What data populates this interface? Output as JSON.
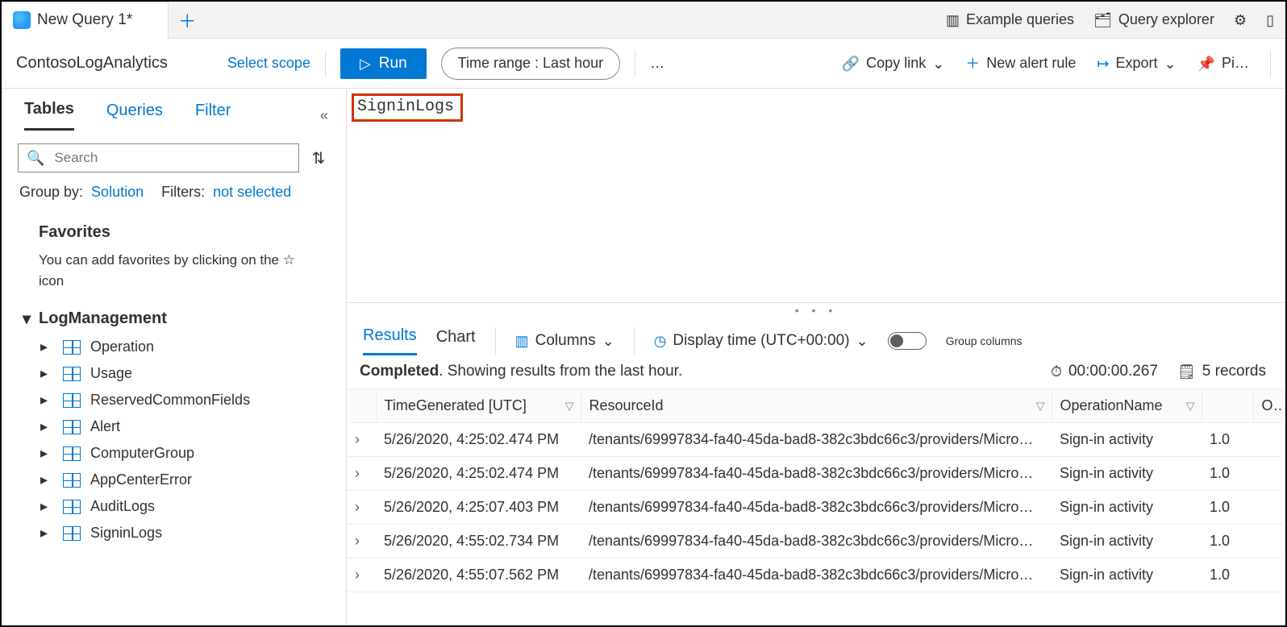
{
  "tabStrip": {
    "activeTab": "New Query 1*",
    "rightItems": {
      "exampleQueries": "Example queries",
      "queryExplorer": "Query explorer"
    }
  },
  "commandBar": {
    "workspace": "ContosoLogAnalytics",
    "selectScope": "Select scope",
    "run": "Run",
    "timeRangeLabel": "Time range :",
    "timeRangeValue": "Last hour",
    "more": "…",
    "copyLink": "Copy link",
    "newAlert": "New alert rule",
    "export": "Export",
    "pin": "Pi…"
  },
  "sidebar": {
    "tabs": {
      "tables": "Tables",
      "queries": "Queries",
      "filter": "Filter"
    },
    "searchPlaceholder": "Search",
    "groupByLabel": "Group by:",
    "groupByValue": "Solution",
    "filtersLabel": "Filters:",
    "filtersValue": "not selected",
    "favoritesTitle": "Favorites",
    "favoritesDesc": "You can add favorites by clicking on the ☆ icon",
    "groupName": "LogManagement",
    "tables": [
      "Operation",
      "Usage",
      "ReservedCommonFields",
      "Alert",
      "ComputerGroup",
      "AppCenterError",
      "AuditLogs",
      "SigninLogs"
    ]
  },
  "editor": {
    "queryText": "SigninLogs"
  },
  "resultsBar": {
    "tabResults": "Results",
    "tabChart": "Chart",
    "columns": "Columns",
    "displayTime": "Display time (UTC+00:00)",
    "groupColumns": "Group columns"
  },
  "statusRow": {
    "completed": "Completed",
    "message": ". Showing results from the last hour.",
    "elapsed": "00:00:00.267",
    "records": "5 records"
  },
  "columns": {
    "time": "TimeGenerated [UTC]",
    "resource": "ResourceId",
    "operation": "OperationName",
    "ope": "Ope"
  },
  "rows": [
    {
      "time": "5/26/2020, 4:25:02.474 PM",
      "resource": "/tenants/69997834-fa40-45da-bad8-382c3bdc66c3/providers/Micro…",
      "op": "Sign-in activity",
      "ver": "1.0"
    },
    {
      "time": "5/26/2020, 4:25:02.474 PM",
      "resource": "/tenants/69997834-fa40-45da-bad8-382c3bdc66c3/providers/Micro…",
      "op": "Sign-in activity",
      "ver": "1.0"
    },
    {
      "time": "5/26/2020, 4:25:07.403 PM",
      "resource": "/tenants/69997834-fa40-45da-bad8-382c3bdc66c3/providers/Micro…",
      "op": "Sign-in activity",
      "ver": "1.0"
    },
    {
      "time": "5/26/2020, 4:55:02.734 PM",
      "resource": "/tenants/69997834-fa40-45da-bad8-382c3bdc66c3/providers/Micro…",
      "op": "Sign-in activity",
      "ver": "1.0"
    },
    {
      "time": "5/26/2020, 4:55:07.562 PM",
      "resource": "/tenants/69997834-fa40-45da-bad8-382c3bdc66c3/providers/Micro…",
      "op": "Sign-in activity",
      "ver": "1.0"
    }
  ]
}
